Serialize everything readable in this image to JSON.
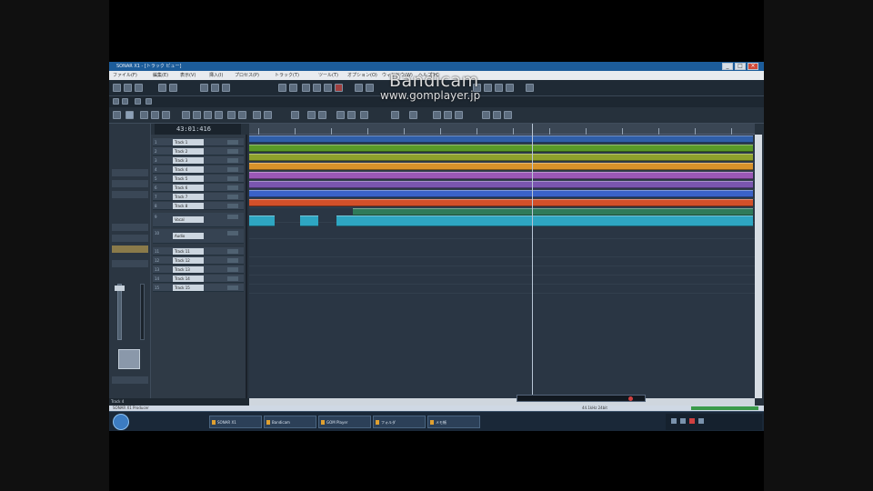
{
  "watermark": {
    "line1": "Bandicam",
    "line2": "www.gomplayer.jp"
  },
  "window": {
    "title": "SONAR X1 - [トラック ビュー]",
    "controls": [
      "_",
      "□",
      "×"
    ]
  },
  "menubar": {
    "items": [
      "ファイル(F)",
      "編集(E)",
      "表示(V)",
      "挿入(I)",
      "プロセス(P)",
      "トラック(T)",
      "ツール(T)",
      "オプション(O)",
      "ウィンドウ(W)",
      "ヘルプ(H)"
    ]
  },
  "transport": {
    "time": "43:01:416"
  },
  "tracks": [
    {
      "num": "1",
      "name": "Track 1"
    },
    {
      "num": "2",
      "name": "Track 2"
    },
    {
      "num": "3",
      "name": "Track 3"
    },
    {
      "num": "4",
      "name": "Track 4"
    },
    {
      "num": "5",
      "name": "Track 5"
    },
    {
      "num": "6",
      "name": "Track 6"
    },
    {
      "num": "7",
      "name": "Track 7"
    },
    {
      "num": "8",
      "name": "Track 8"
    },
    {
      "num": "9",
      "name": "Vocal"
    },
    {
      "num": "10",
      "name": "Audio"
    },
    {
      "num": "11",
      "name": "Track 11"
    },
    {
      "num": "12",
      "name": "Track 12"
    },
    {
      "num": "13",
      "name": "Track 13"
    },
    {
      "num": "14",
      "name": "Track 14"
    },
    {
      "num": "15",
      "name": "Track 15"
    }
  ],
  "parts_colors": {
    "blue_dark": "#2f5ea8",
    "green": "#5a9a28",
    "olive": "#8fa12c",
    "orange": "#d8922a",
    "purple": "#9a58b6",
    "violet": "#7a56b0",
    "blue": "#3a62c8",
    "red_orange": "#d2502a",
    "teal": "#2ea6c2",
    "dark_green": "#2f7a5a"
  },
  "status": {
    "left": "Track 4",
    "stripe_left": "SONAR X1 Producer",
    "stripe_right": "44.1kHz 24bit"
  },
  "taskbar": {
    "items": [
      "SONAR X1",
      "Bandicam",
      "GOM Player",
      "フォルダ",
      "メモ帳"
    ]
  }
}
